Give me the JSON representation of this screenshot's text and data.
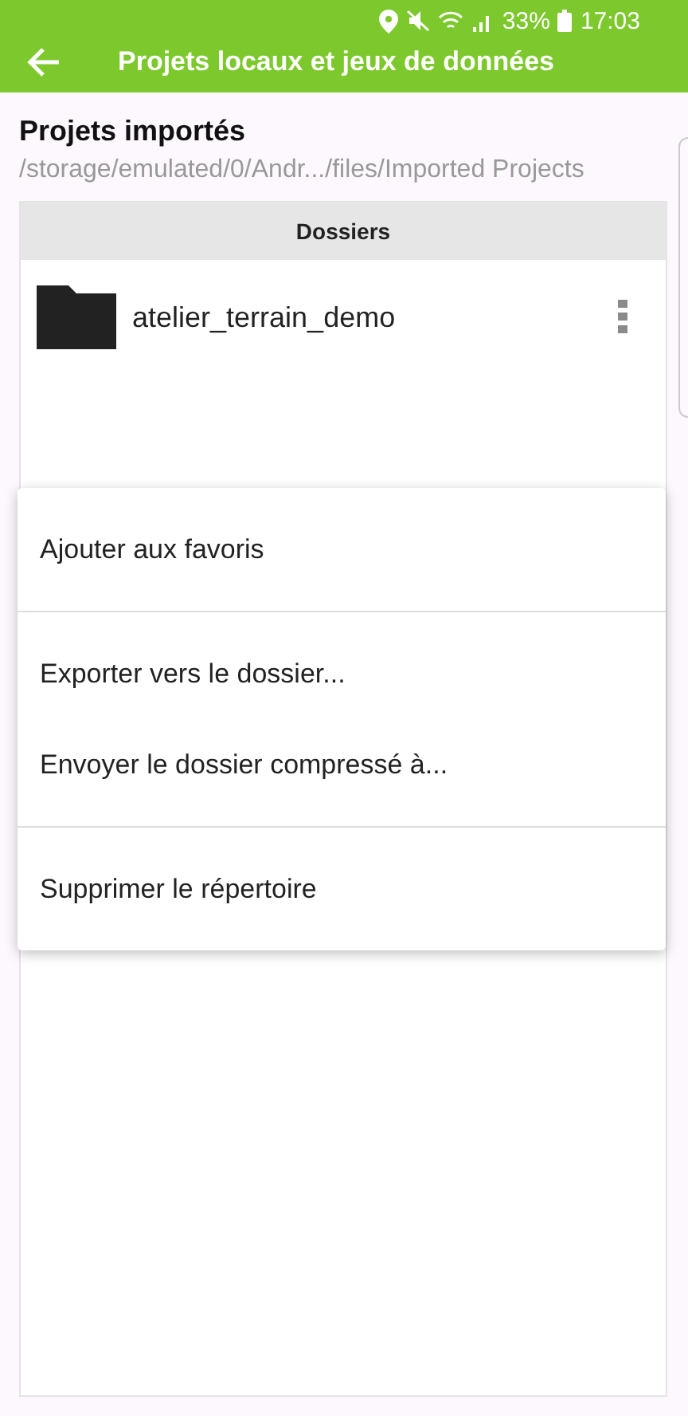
{
  "status_bar": {
    "battery": "33%",
    "time": "17:03"
  },
  "app_bar": {
    "title": "Projets locaux et jeux de données"
  },
  "section": {
    "title": "Projets importés",
    "path": "/storage/emulated/0/Andr.../files/Imported Projects"
  },
  "table": {
    "header": "Dossiers",
    "rows": [
      {
        "name": "atelier_terrain_demo"
      }
    ]
  },
  "menu": {
    "groups": [
      {
        "items": [
          "Ajouter aux favoris"
        ]
      },
      {
        "items": [
          "Exporter vers le dossier...",
          "Envoyer le dossier compressé à..."
        ]
      },
      {
        "items": [
          "Supprimer le répertoire"
        ]
      }
    ]
  }
}
